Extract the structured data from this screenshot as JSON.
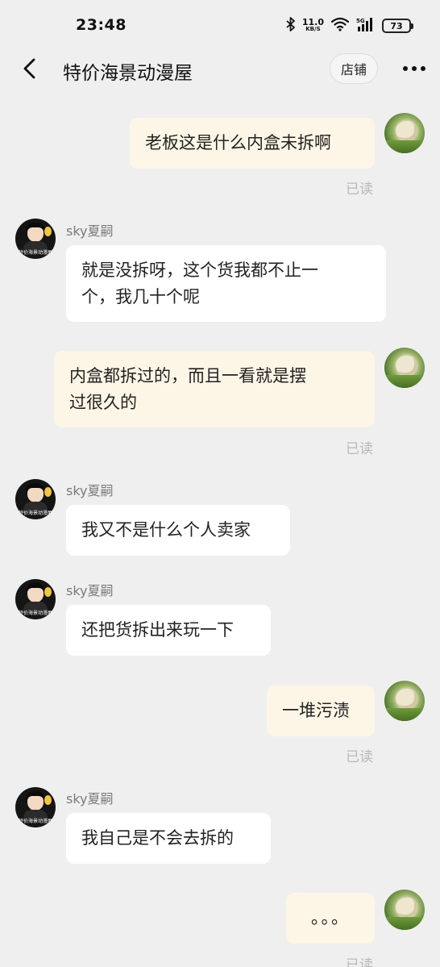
{
  "status_bar": {
    "time": "23:48",
    "speed_value": "11.0",
    "speed_unit": "KB/S",
    "network": "5G",
    "battery": "73",
    "icons": [
      "bluetooth-icon",
      "wifi-icon",
      "signal-icon",
      "battery-icon"
    ]
  },
  "header": {
    "title": "特价海景动漫屋",
    "store_label": "店铺",
    "icons": [
      "back-arrow-icon",
      "more-icon"
    ]
  },
  "shop_avatar_text": "特价海景动漫屋",
  "colors": {
    "background": "#efefef",
    "my_bubble": "#fdf6e6",
    "their_bubble": "#ffffff",
    "read_text": "#b8b8b8",
    "sender_text": "#7a7a7a"
  },
  "messages": [
    {
      "from": "me",
      "text": "老板这是什么内盒未拆啊",
      "status": "已读"
    },
    {
      "from": "shop",
      "sender": "sky夏嗣",
      "text_lines": [
        "就是没拆呀，这个货我都不止一",
        "个，我几十个呢"
      ]
    },
    {
      "from": "me",
      "text_lines": [
        "内盒都拆过的，而且一看就是摆",
        "过很久的"
      ],
      "status": "已读"
    },
    {
      "from": "shop",
      "sender": "sky夏嗣",
      "text": "我又不是什么个人卖家"
    },
    {
      "from": "shop",
      "sender": "sky夏嗣",
      "text": "还把货拆出来玩一下"
    },
    {
      "from": "me",
      "text": "一堆污渍",
      "status": "已读"
    },
    {
      "from": "shop",
      "sender": "sky夏嗣",
      "text": "我自己是不会去拆的"
    },
    {
      "from": "me",
      "text": "。。。",
      "status": "已读"
    }
  ]
}
